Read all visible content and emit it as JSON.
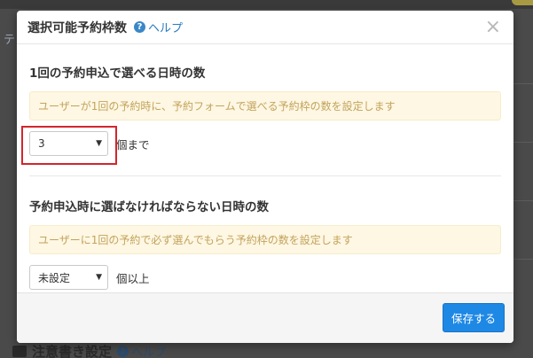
{
  "background": {
    "tab_fragment": "テ",
    "section_title": "注意書き設定",
    "section_help": "ヘルプ"
  },
  "modal": {
    "title": "選択可能予約枠数",
    "help_label": "ヘルプ",
    "help_icon_glyph": "?",
    "close_glyph": "×",
    "section1": {
      "title": "1回の予約申込で選べる日時の数",
      "info": "ユーザーが1回の予約時に、予約フォームで選べる予約枠の数を設定します",
      "select_value": "3",
      "unit": "個まで"
    },
    "section2": {
      "title": "予約申込時に選ばなければならない日時の数",
      "info": "ユーザーに1回の予約で必ず選んでもらう予約枠の数を設定します",
      "select_value": "未設定",
      "unit": "個以上"
    },
    "caret_glyph": "▼",
    "save_label": "保存する"
  },
  "colors": {
    "accent": "#1e88e5",
    "highlight": "#d3262b",
    "info_bg": "#fdf7e3",
    "info_text": "#c4a35c"
  }
}
